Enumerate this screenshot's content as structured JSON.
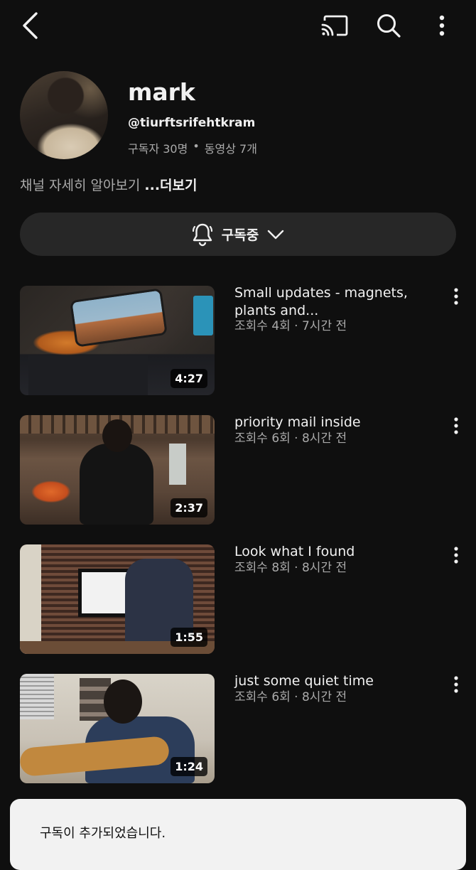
{
  "topbar": {
    "icons": [
      "back-arrow-icon",
      "cast-icon",
      "search-icon",
      "more-vertical-icon"
    ]
  },
  "channel": {
    "name": "mark",
    "handle": "@tiurftsrifehtkram",
    "subscribers": "구독자 30명",
    "separator": "•",
    "videos": "동영상 7개",
    "about_text": "채널 자세히 알아보기",
    "about_more": "...더보기",
    "subscribe_label": "구독중"
  },
  "videos": [
    {
      "title": "Small updates - magnets, plants and...",
      "meta": "조회수 4회 · 7시간 전",
      "duration": "4:27"
    },
    {
      "title": "priority mail inside",
      "meta": "조회수 6회 · 8시간 전",
      "duration": "2:37"
    },
    {
      "title": "Look what I found",
      "meta": "조회수 8회 · 8시간 전",
      "duration": "1:55"
    },
    {
      "title": "just some quiet time",
      "meta": "조회수 6회 · 8시간 전",
      "duration": "1:24"
    }
  ],
  "toast": {
    "message": "구독이 추가되었습니다."
  },
  "colors": {
    "background": "#0f0f0f",
    "text_primary": "#f1f1f1",
    "text_secondary": "#aaaaaa",
    "button_bg": "#272727",
    "toast_bg": "#f2f2f2"
  }
}
